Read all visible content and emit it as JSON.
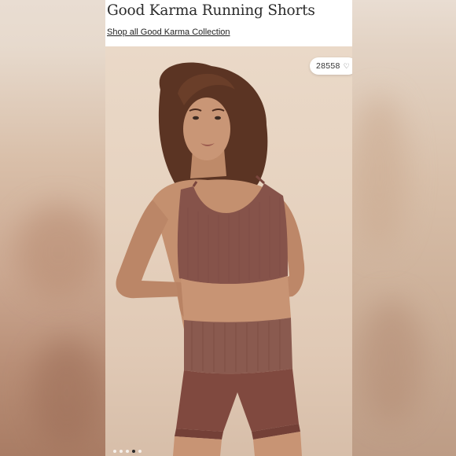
{
  "product": {
    "title": "Good Karma Running Shorts",
    "collection_link": "Shop all Good Karma Collection"
  },
  "gallery": {
    "likes_count": "28558",
    "heart_icon": "heart-icon",
    "image_count": 5,
    "active_index": 3,
    "image_alt": "Model wearing brown ribbed crop top and high-waist running shorts"
  },
  "colors": {
    "background_blur": "#c7ad98",
    "garment": "#86534a",
    "skin": "#c4906f",
    "hair": "#5b3423",
    "photo_backdrop": "#e6d2bf"
  }
}
